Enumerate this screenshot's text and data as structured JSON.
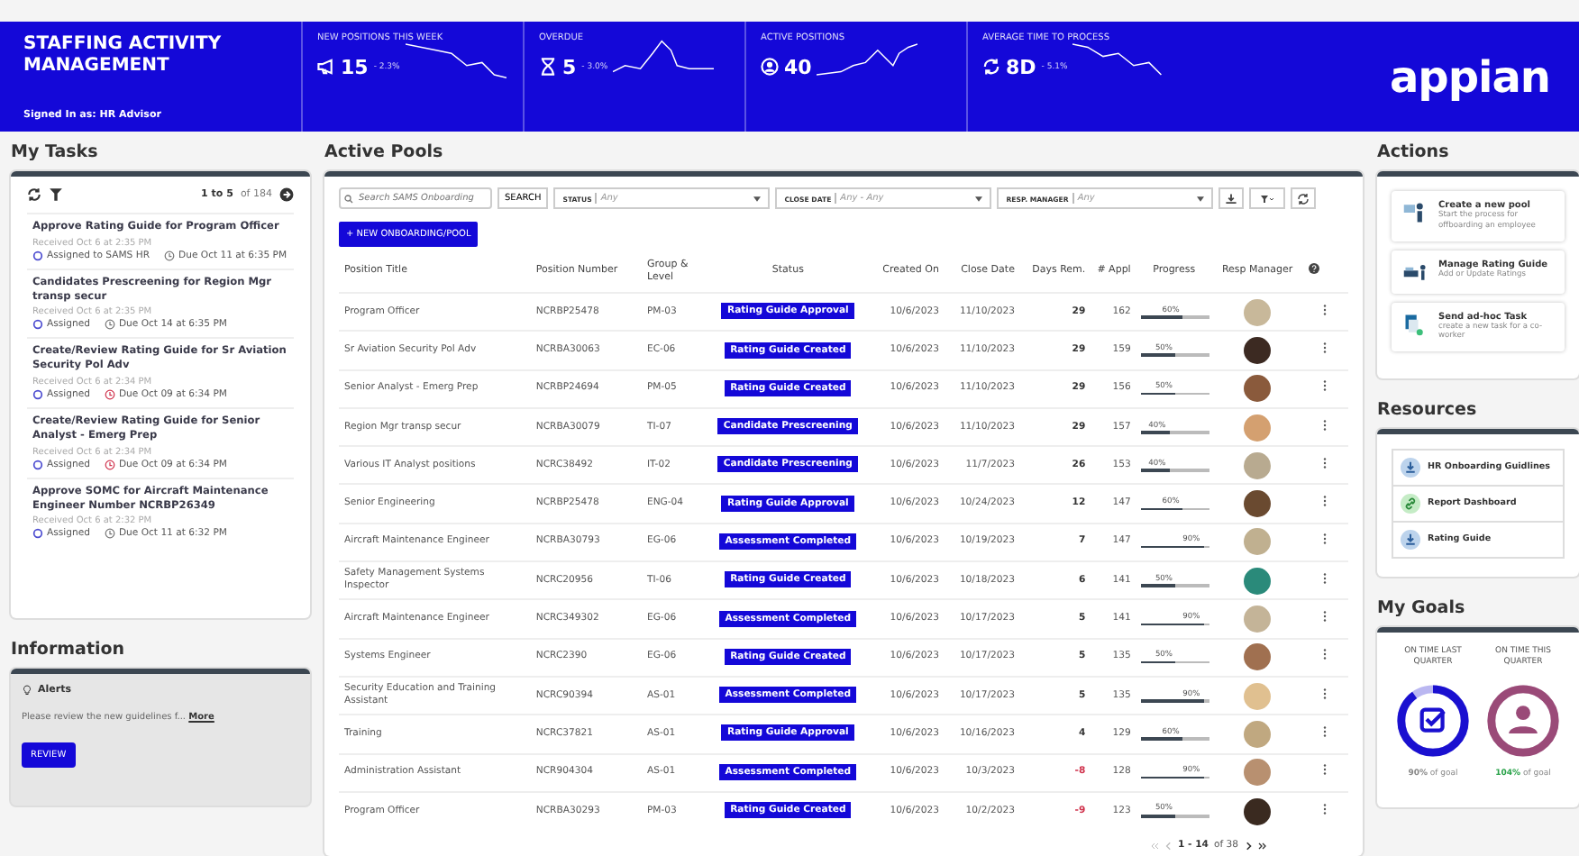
{
  "header": {
    "title": "STAFFING ACTIVITY MANAGEMENT",
    "signed_in_label": "Signed In as:",
    "signed_in_user": "HR Advisor",
    "logo": "appian",
    "kpis": [
      {
        "label": "NEW POSITIONS THIS WEEK",
        "kind": "megaphone",
        "value": "15",
        "delta": "- 2.3%"
      },
      {
        "label": "OVERDUE",
        "kind": "hourglass",
        "value": "5",
        "delta": "- 3.0%"
      },
      {
        "label": "ACTIVE POSITIONS",
        "kind": "person",
        "value": "40"
      },
      {
        "label": "AVERAGE TIME TO PROCESS",
        "kind": "refresh",
        "value": "8D",
        "delta": "- 5.1%"
      }
    ]
  },
  "tasks": {
    "heading": "My Tasks",
    "paging": "1 to 5",
    "of": "of 184",
    "items": [
      {
        "title": "Approve Rating Guide for Program Officer",
        "received": "Received Oct 6 at 2:35 PM",
        "assigned": "Assigned to SAMS HR",
        "due": "Due Oct 11 at 6:35 PM",
        "overdue": false
      },
      {
        "title": "Candidates Prescreening for Region Mgr transp secur",
        "received": "Received Oct 6 at 2:35 PM",
        "assigned": "Assigned",
        "due": "Due Oct 14 at 6:35 PM",
        "overdue": false
      },
      {
        "title": "Create/Review Rating Guide for Sr Aviation Security Pol Adv",
        "received": "Received Oct 6 at 2:34 PM",
        "assigned": "Assigned",
        "due": "Due Oct 09 at 6:34 PM",
        "overdue": true
      },
      {
        "title": "Create/Review Rating Guide for Senior Analyst - Emerg Prep",
        "received": "Received Oct 6 at 2:34 PM",
        "assigned": "Assigned",
        "due": "Due Oct 09 at 6:34 PM",
        "overdue": true
      },
      {
        "title": "Approve SOMC for Aircraft Maintenance Engineer Number NCRBP26349",
        "received": "Received Oct 6 at 2:32 PM",
        "assigned": "Assigned",
        "due": "Due Oct 11 at 6:32 PM",
        "overdue": false
      }
    ]
  },
  "information": {
    "heading": "Information",
    "alerts_title": "Alerts",
    "message": "Please review the new guidelines f...",
    "more_link": "More",
    "button": "REVIEW"
  },
  "pools": {
    "heading": "Active Pools",
    "search": {
      "placeholder": "Search SAMS Onboarding"
    },
    "search_button": "SEARCH",
    "filters": [
      {
        "label": "STATUS",
        "value": "Any"
      },
      {
        "label": "CLOSE DATE",
        "value": "Any - Any"
      },
      {
        "label": "RESP. MANAGER",
        "value": "Any"
      }
    ],
    "new_button": "+ NEW ONBOARDING/POOL",
    "columns": [
      "Position Title",
      "Position Number",
      "Group & Level",
      "Status",
      "Created On",
      "Close Date",
      "Days Rem.",
      "# Appl",
      "Progress",
      "Resp Manager"
    ],
    "rows": [
      {
        "title": "Program Officer",
        "number": "NCRBP25478",
        "group": "PM-03",
        "status": "Rating Guide Approval",
        "created": "10/6/2023",
        "close": "11/10/2023",
        "days": "29",
        "overdue": false,
        "appl": "162",
        "progress": "60%",
        "level": 0.6
      },
      {
        "title": "Sr Aviation Security Pol Adv",
        "number": "NCRBA30063",
        "group": "EC-06",
        "status": "Rating Guide Created",
        "created": "10/6/2023",
        "close": "11/10/2023",
        "days": "29",
        "overdue": false,
        "appl": "159",
        "progress": "50%",
        "level": 0.5
      },
      {
        "title": "Senior Analyst - Emerg Prep",
        "number": "NCRBP24694",
        "group": "PM-05",
        "status": "Rating Guide Created",
        "created": "10/6/2023",
        "close": "11/10/2023",
        "days": "29",
        "overdue": false,
        "appl": "156",
        "progress": "50%",
        "level": 0.5
      },
      {
        "title": "Region Mgr transp secur",
        "number": "NCRBA30079",
        "group": "TI-07",
        "status": "Candidate Prescreening",
        "created": "10/6/2023",
        "close": "11/10/2023",
        "days": "29",
        "overdue": false,
        "appl": "157",
        "progress": "40%",
        "level": 0.4
      },
      {
        "title": "Various IT Analyst positions",
        "number": "NCRC38492",
        "group": "IT-02",
        "status": "Candidate Prescreening",
        "created": "10/6/2023",
        "close": "11/7/2023",
        "days": "26",
        "overdue": false,
        "appl": "153",
        "progress": "40%",
        "level": 0.4
      },
      {
        "title": "Senior Engineering",
        "number": "NCRBP25478",
        "group": "ENG-04",
        "status": "Rating Guide Approval",
        "created": "10/6/2023",
        "close": "10/24/2023",
        "days": "12",
        "overdue": false,
        "appl": "147",
        "progress": "60%",
        "level": 0.6
      },
      {
        "title": "Aircraft Maintenance Engineer",
        "number": "NCRBA30793",
        "group": "EG-06",
        "status": "Assessment Completed",
        "created": "10/6/2023",
        "close": "10/19/2023",
        "days": "7",
        "overdue": false,
        "appl": "147",
        "progress": "90%",
        "level": 0.9
      },
      {
        "title": "Safety Management Systems Inspector",
        "number": "NCRC20956",
        "group": "TI-06",
        "status": "Rating Guide Created",
        "created": "10/6/2023",
        "close": "10/18/2023",
        "days": "6",
        "overdue": false,
        "appl": "141",
        "progress": "50%",
        "level": 0.5
      },
      {
        "title": "Aircraft Maintenance Engineer",
        "number": "NCRC349302",
        "group": "EG-06",
        "status": "Assessment Completed",
        "created": "10/6/2023",
        "close": "10/17/2023",
        "days": "5",
        "overdue": false,
        "appl": "141",
        "progress": "90%",
        "level": 0.9
      },
      {
        "title": "Systems Engineer",
        "number": "NCRC2390",
        "group": "EG-06",
        "status": "Rating Guide Created",
        "created": "10/6/2023",
        "close": "10/17/2023",
        "days": "5",
        "overdue": false,
        "appl": "135",
        "progress": "50%",
        "level": 0.5
      },
      {
        "title": "Security Education and Training Assistant",
        "number": "NCRC90394",
        "group": "AS-01",
        "status": "Assessment Completed",
        "created": "10/6/2023",
        "close": "10/17/2023",
        "days": "5",
        "overdue": false,
        "appl": "135",
        "progress": "90%",
        "level": 0.9
      },
      {
        "title": "Training",
        "number": "NCRC37821",
        "group": "AS-01",
        "status": "Rating Guide Approval",
        "created": "10/6/2023",
        "close": "10/16/2023",
        "days": "4",
        "overdue": false,
        "appl": "129",
        "progress": "60%",
        "level": 0.6
      },
      {
        "title": "Administration Assistant",
        "number": "NCR904304",
        "group": "AS-01",
        "status": "Assessment Completed",
        "created": "10/6/2023",
        "close": "10/3/2023",
        "days": "-8",
        "overdue": true,
        "appl": "128",
        "progress": "90%",
        "level": 0.9
      },
      {
        "title": "Program Officer",
        "number": "NCRBA30293",
        "group": "PM-03",
        "status": "Rating Guide Created",
        "created": "10/6/2023",
        "close": "10/2/2023",
        "days": "-9",
        "overdue": true,
        "appl": "123",
        "progress": "50%",
        "level": 0.5
      }
    ],
    "pagination": "1 - 14",
    "pagination_of": "of 38"
  },
  "actions": {
    "heading": "Actions",
    "items": [
      {
        "kind": "pool",
        "title": "Create a new pool",
        "subtitle": "Start the process for offboarding an employee"
      },
      {
        "kind": "guide",
        "title": "Manage Rating Guide",
        "subtitle": "Add or Update Ratings"
      },
      {
        "kind": "task",
        "title": "Send ad-hoc Task",
        "subtitle": "create a new task for a co-worker"
      }
    ]
  },
  "resources": {
    "heading": "Resources",
    "items": [
      {
        "kind": "download",
        "label": "HR Onboarding Guidlines"
      },
      {
        "kind": "link",
        "label": "Report Dashboard"
      },
      {
        "kind": "download",
        "label": "Rating Guide"
      }
    ]
  },
  "goals": {
    "heading": "My Goals",
    "items": [
      {
        "label": "ON TIME LAST QUARTER",
        "kind": "check",
        "level": 0.9,
        "color": "#1a10d0",
        "percent": "90%",
        "suffix": "of goal",
        "exceeded": false
      },
      {
        "label": "ON TIME THIS QUARTER",
        "kind": "person",
        "level": 1,
        "color": "#9a4a78",
        "percent": "104%",
        "suffix": "of goal",
        "exceeded": true
      }
    ]
  }
}
